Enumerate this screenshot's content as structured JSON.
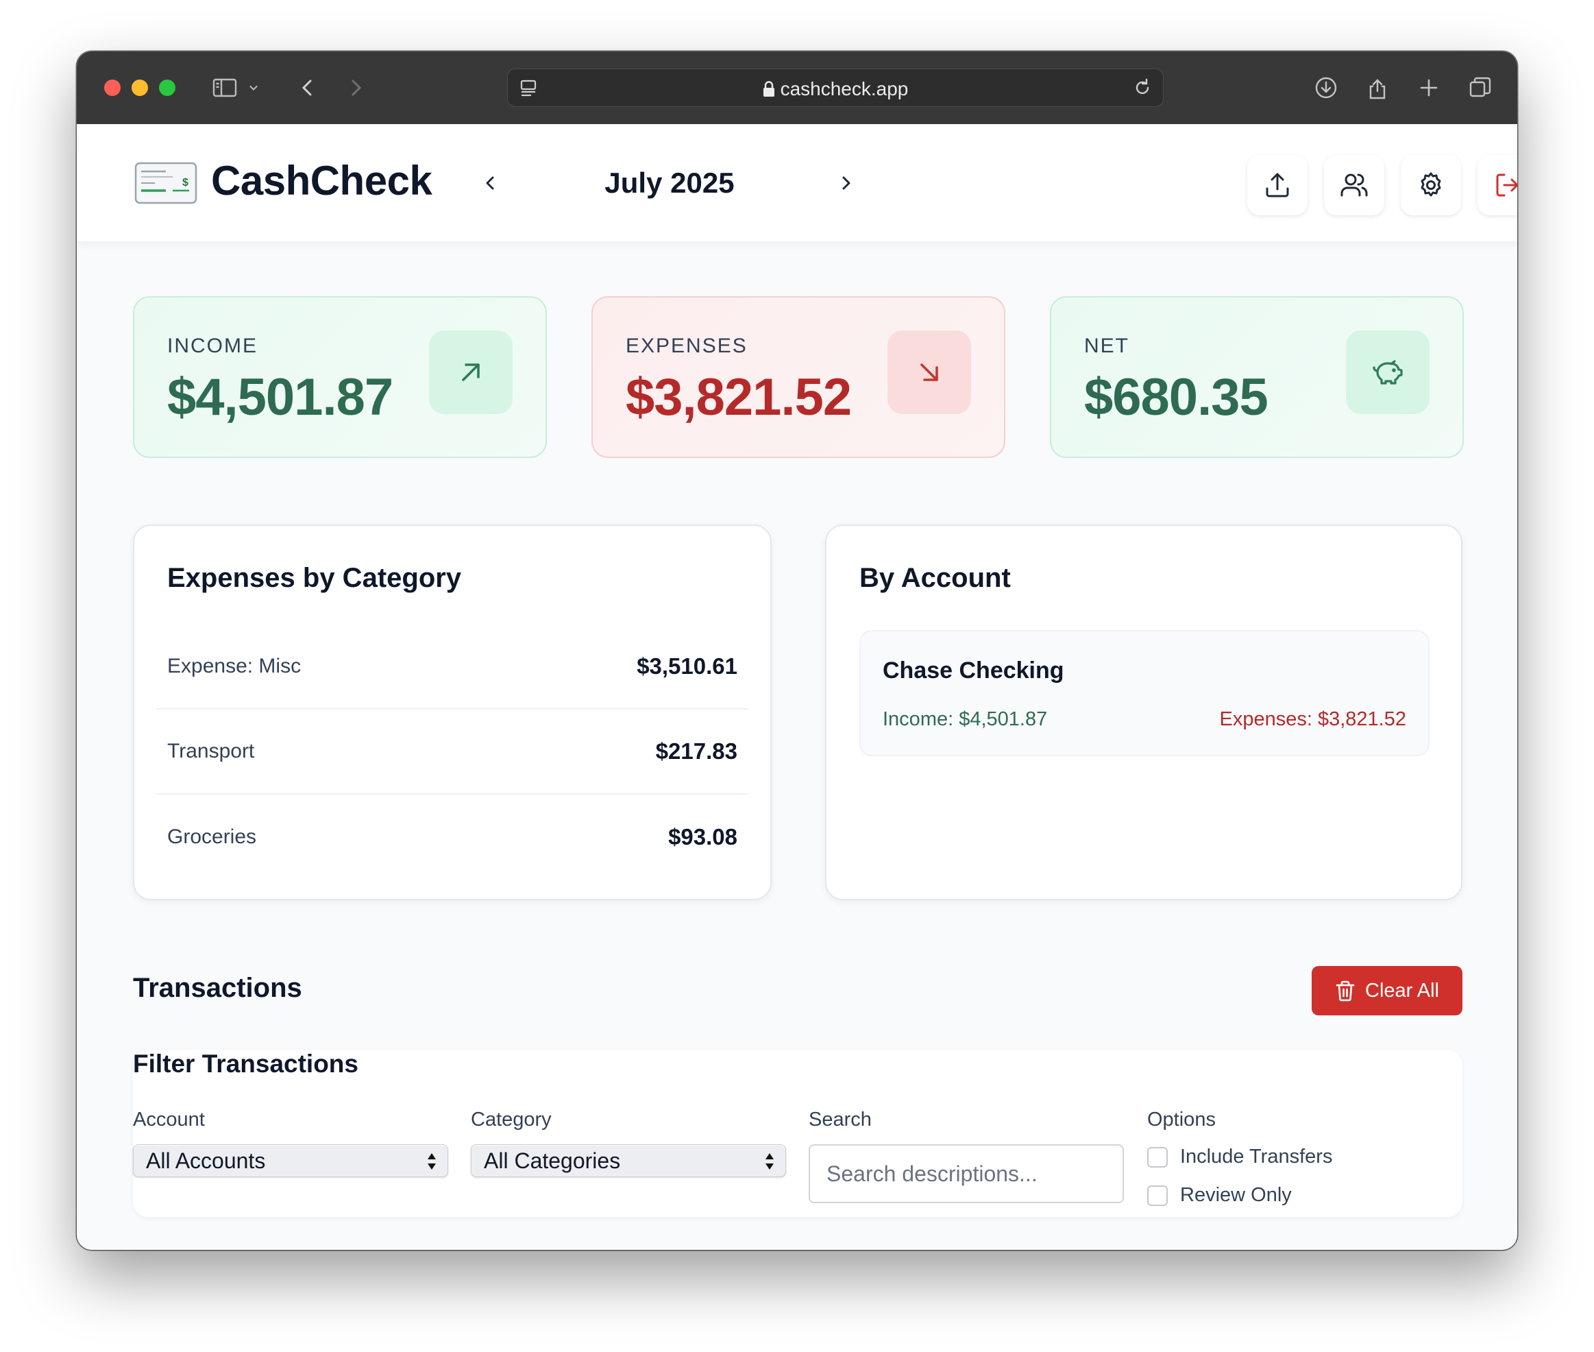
{
  "browser": {
    "url": "cashcheck.app"
  },
  "header": {
    "brand": "CashCheck",
    "month": "July 2025",
    "icons": [
      "upload-icon",
      "users-icon",
      "settings-icon",
      "logout-icon"
    ]
  },
  "stats": {
    "income": {
      "label": "INCOME",
      "value": "$4,501.87",
      "icon": "arrow-up-right-icon"
    },
    "expenses": {
      "label": "EXPENSES",
      "value": "$3,821.52",
      "icon": "arrow-down-right-icon"
    },
    "net": {
      "label": "NET",
      "value": "$680.35",
      "icon": "piggy-bank-icon"
    }
  },
  "colors": {
    "positive": "#2e6b51",
    "negative": "#b42a2a",
    "danger_button": "#cf302c"
  },
  "expenses_by_category": {
    "title": "Expenses by Category",
    "rows": [
      {
        "name": "Expense: Misc",
        "amount": "$3,510.61"
      },
      {
        "name": "Transport",
        "amount": "$217.83"
      },
      {
        "name": "Groceries",
        "amount": "$93.08"
      }
    ]
  },
  "by_account": {
    "title": "By Account",
    "accounts": [
      {
        "name": "Chase Checking",
        "income": "Income: $4,501.87",
        "expenses": "Expenses: $3,821.52"
      }
    ]
  },
  "transactions": {
    "title": "Transactions",
    "clear_label": "Clear All"
  },
  "filters": {
    "title": "Filter Transactions",
    "account_label": "Account",
    "account_value": "All Accounts",
    "category_label": "Category",
    "category_value": "All Categories",
    "search_label": "Search",
    "search_placeholder": "Search descriptions...",
    "options_label": "Options",
    "include_transfers": "Include Transfers",
    "review_only": "Review Only"
  }
}
